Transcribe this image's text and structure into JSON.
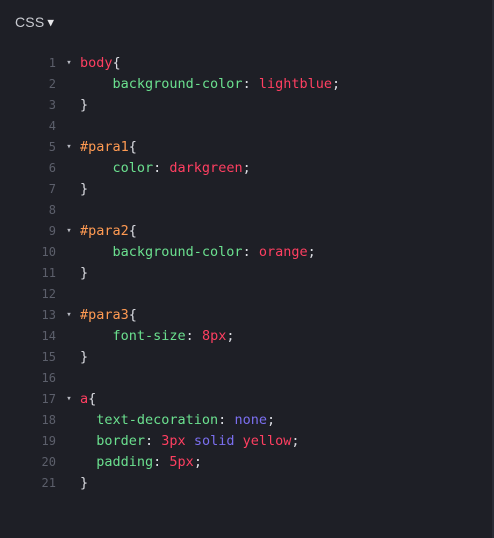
{
  "header": {
    "language_label": "CSS",
    "caret": "▼"
  },
  "editor": {
    "lines": [
      {
        "num": "1",
        "fold": "▾",
        "tokens": [
          {
            "t": "body",
            "c": "sel-tag"
          },
          {
            "t": "{",
            "c": "brace"
          }
        ]
      },
      {
        "num": "2",
        "fold": "",
        "tokens": [
          {
            "t": "    background-color",
            "c": "prop"
          },
          {
            "t": ": ",
            "c": "punct"
          },
          {
            "t": "lightblue",
            "c": "val"
          },
          {
            "t": ";",
            "c": "punct"
          }
        ]
      },
      {
        "num": "3",
        "fold": "",
        "tokens": [
          {
            "t": "}",
            "c": "brace"
          }
        ]
      },
      {
        "num": "4",
        "fold": "",
        "tokens": []
      },
      {
        "num": "5",
        "fold": "▾",
        "tokens": [
          {
            "t": "#para1",
            "c": "sel-id"
          },
          {
            "t": "{",
            "c": "brace"
          }
        ]
      },
      {
        "num": "6",
        "fold": "",
        "tokens": [
          {
            "t": "    color",
            "c": "prop"
          },
          {
            "t": ": ",
            "c": "punct"
          },
          {
            "t": "darkgreen",
            "c": "val"
          },
          {
            "t": ";",
            "c": "punct"
          }
        ]
      },
      {
        "num": "7",
        "fold": "",
        "tokens": [
          {
            "t": "}",
            "c": "brace"
          }
        ]
      },
      {
        "num": "8",
        "fold": "",
        "tokens": []
      },
      {
        "num": "9",
        "fold": "▾",
        "tokens": [
          {
            "t": "#para2",
            "c": "sel-id"
          },
          {
            "t": "{",
            "c": "brace"
          }
        ]
      },
      {
        "num": "10",
        "fold": "",
        "tokens": [
          {
            "t": "    background-color",
            "c": "prop"
          },
          {
            "t": ": ",
            "c": "punct"
          },
          {
            "t": "orange",
            "c": "val"
          },
          {
            "t": ";",
            "c": "punct"
          }
        ]
      },
      {
        "num": "11",
        "fold": "",
        "tokens": [
          {
            "t": "}",
            "c": "brace"
          }
        ]
      },
      {
        "num": "12",
        "fold": "",
        "tokens": []
      },
      {
        "num": "13",
        "fold": "▾",
        "tokens": [
          {
            "t": "#para3",
            "c": "sel-id"
          },
          {
            "t": "{",
            "c": "brace"
          }
        ]
      },
      {
        "num": "14",
        "fold": "",
        "tokens": [
          {
            "t": "    font-size",
            "c": "prop"
          },
          {
            "t": ": ",
            "c": "punct"
          },
          {
            "t": "8px",
            "c": "val"
          },
          {
            "t": ";",
            "c": "punct"
          }
        ]
      },
      {
        "num": "15",
        "fold": "",
        "tokens": [
          {
            "t": "}",
            "c": "brace"
          }
        ]
      },
      {
        "num": "16",
        "fold": "",
        "tokens": []
      },
      {
        "num": "17",
        "fold": "▾",
        "tokens": [
          {
            "t": "a",
            "c": "sel-tag"
          },
          {
            "t": "{",
            "c": "brace"
          }
        ]
      },
      {
        "num": "18",
        "fold": "",
        "tokens": [
          {
            "t": "  text-decoration",
            "c": "prop"
          },
          {
            "t": ": ",
            "c": "punct"
          },
          {
            "t": "none",
            "c": "val-kw"
          },
          {
            "t": ";",
            "c": "punct"
          }
        ]
      },
      {
        "num": "19",
        "fold": "",
        "tokens": [
          {
            "t": "  border",
            "c": "prop"
          },
          {
            "t": ": ",
            "c": "punct"
          },
          {
            "t": "3px",
            "c": "val"
          },
          {
            "t": " ",
            "c": "punct"
          },
          {
            "t": "solid",
            "c": "val-kw"
          },
          {
            "t": " ",
            "c": "punct"
          },
          {
            "t": "yellow",
            "c": "val"
          },
          {
            "t": ";",
            "c": "punct"
          }
        ]
      },
      {
        "num": "20",
        "fold": "",
        "tokens": [
          {
            "t": "  padding",
            "c": "prop"
          },
          {
            "t": ": ",
            "c": "punct"
          },
          {
            "t": "5px",
            "c": "val"
          },
          {
            "t": ";",
            "c": "punct"
          }
        ]
      },
      {
        "num": "21",
        "fold": "",
        "tokens": [
          {
            "t": "}",
            "c": "brace"
          }
        ]
      }
    ]
  },
  "colors": {
    "background": "#1e1f26",
    "selector_tag": "#ff3f61",
    "selector_id": "#ff9a52",
    "property": "#6be08f",
    "value": "#ff3f61",
    "keyword_value": "#7b6ff0",
    "line_number": "#5c5f6b"
  }
}
